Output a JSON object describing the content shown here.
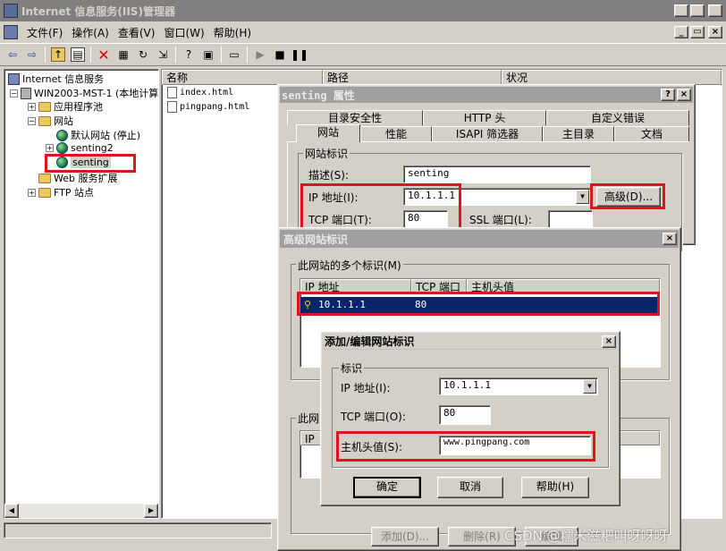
{
  "main_window": {
    "title": "Internet 信息服务(IIS)管理器",
    "menu": [
      "文件(F)",
      "操作(A)",
      "查看(V)",
      "窗口(W)",
      "帮助(H)"
    ]
  },
  "tree": {
    "root": "Internet 信息服务",
    "server": "WIN2003-MST-1 (本地计算",
    "app_pools": "应用程序池",
    "websites": "网站",
    "default_site": "默认网站 (停止)",
    "senting2": "senting2",
    "senting": "senting",
    "web_ext": "Web 服务扩展",
    "ftp": "FTP 站点"
  },
  "file_list": {
    "columns": [
      "名称",
      "路径",
      "状况"
    ],
    "files": [
      "index.html",
      "pingpang.html"
    ]
  },
  "properties_dialog": {
    "title": "senting 属性",
    "tabs_row1": [
      "目录安全性",
      "HTTP 头",
      "自定义错误"
    ],
    "tabs_row2": [
      "网站",
      "性能",
      "ISAPI 筛选器",
      "主目录",
      "文档"
    ],
    "group_label": "网站标识",
    "desc_label": "描述(S):",
    "desc_value": "senting",
    "ip_label": "IP 地址(I):",
    "ip_value": "10.1.1.1",
    "tcp_label": "TCP 端口(T):",
    "tcp_value": "80",
    "ssl_label": "SSL 端口(L):",
    "ssl_value": "",
    "advanced_button": "高级(D)..."
  },
  "advanced_dialog": {
    "title": "高级网站标识",
    "group_label": "此网站的多个标识(M)",
    "columns": [
      "IP 地址",
      "TCP 端口",
      "主机头值"
    ],
    "rows": [
      {
        "ip": "10.1.1.1",
        "port": "80",
        "host": ""
      }
    ],
    "group2_label": "此网",
    "col2": "IP",
    "add_button": "添加(D)...",
    "delete_button": "删除(R)",
    "edit_button": "编辑"
  },
  "edit_dialog": {
    "title": "添加/编辑网站标识",
    "group_label": "标识",
    "ip_label": "IP 地址(I):",
    "ip_value": "10.1.1.1",
    "tcp_label": "TCP 端口(O):",
    "tcp_value": "80",
    "host_label": "主机头值(S):",
    "host_value": "www.pingpang.com",
    "ok_button": "确定",
    "cancel_button": "取消",
    "help_button": "帮助(H)"
  },
  "watermark": "CSDN @糯米滋粑叫呀呀呀",
  "colors": {
    "highlight_box": "#e0141e",
    "selection": "#0a246a",
    "title_inactive": "#808080"
  }
}
